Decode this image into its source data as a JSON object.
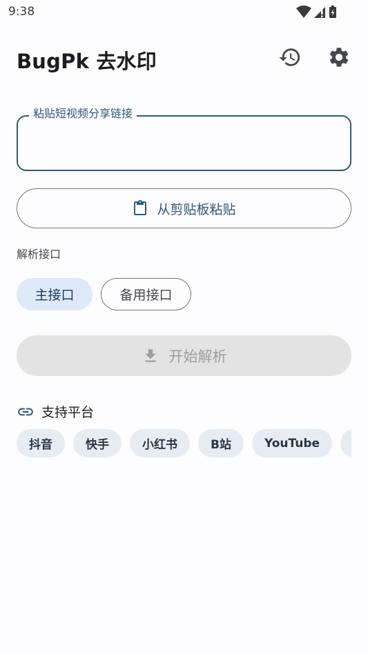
{
  "status_bar": {
    "time": "9:38"
  },
  "app_bar": {
    "title": "BugPk 去水印",
    "history_icon": "history-icon",
    "settings_icon": "gear-icon"
  },
  "url_field": {
    "label": "粘贴短视频分享链接",
    "value": "",
    "placeholder": ""
  },
  "paste_button": {
    "label": "从剪贴板粘贴",
    "icon": "clipboard-icon"
  },
  "api_section": {
    "label": "解析接口",
    "options": [
      {
        "label": "主接口",
        "selected": true
      },
      {
        "label": "备用接口",
        "selected": false
      }
    ]
  },
  "parse_button": {
    "label": "开始解析",
    "icon": "download-icon",
    "enabled": false
  },
  "platforms": {
    "title": "支持平台",
    "icon": "link-icon",
    "items": [
      "抖音",
      "快手",
      "小红书",
      "B站",
      "YouTube",
      ""
    ]
  },
  "colors": {
    "primary": "#2c5a7c",
    "chip_selected_bg": "#dde9f8",
    "platform_chip_bg": "#e7ecf2",
    "disabled_bg": "#e3e3e3"
  }
}
